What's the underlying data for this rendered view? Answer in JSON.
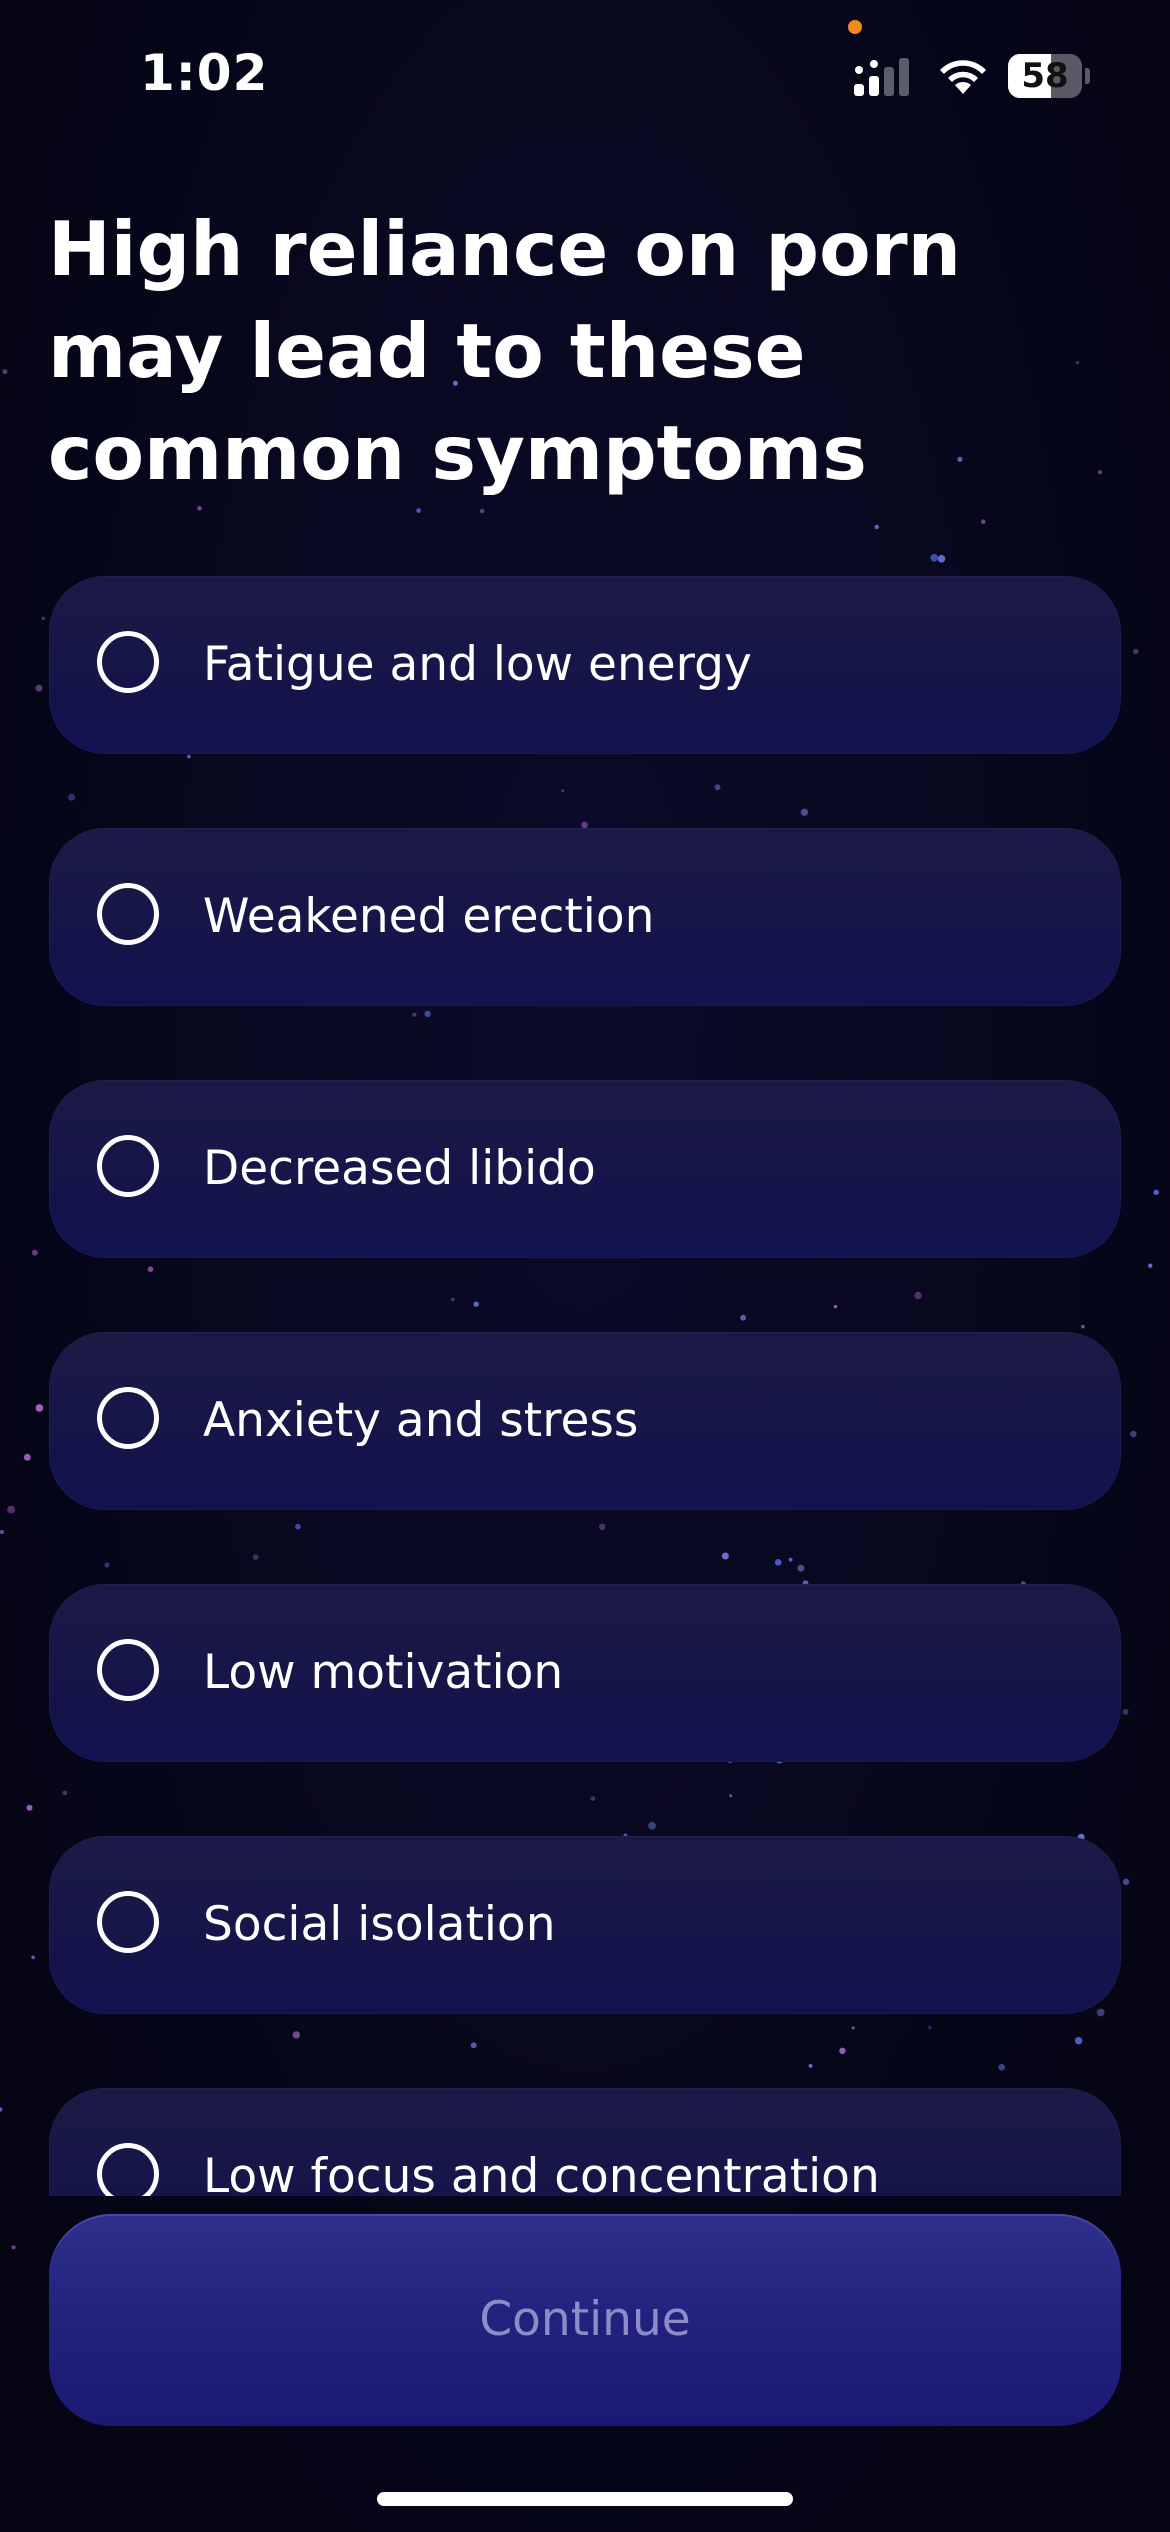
{
  "status_bar": {
    "time": "1:02",
    "battery_level": "58",
    "battery_fraction": 0.58
  },
  "headline": "High reliance on porn may lead to these common symptoms",
  "options": [
    {
      "label": "Fatigue and low energy",
      "selected": false
    },
    {
      "label": "Weakened erection",
      "selected": false
    },
    {
      "label": "Decreased libido",
      "selected": false
    },
    {
      "label": "Anxiety and stress",
      "selected": false
    },
    {
      "label": "Low motivation",
      "selected": false
    },
    {
      "label": "Social isolation",
      "selected": false
    },
    {
      "label": "Low focus and concentration",
      "selected": false
    }
  ],
  "continue_button": {
    "label": "Continue",
    "enabled": false
  },
  "icons": {
    "signal": "cellular-signal-icon",
    "wifi": "wifi-icon",
    "battery": "battery-icon",
    "radio": "radio-unchecked-icon"
  },
  "colors": {
    "background": "#06061a",
    "option_background": "#17174a",
    "button_background": "#24247f",
    "button_label_disabled": "#8c8cc8",
    "accent_dot": "#f08a1c"
  }
}
